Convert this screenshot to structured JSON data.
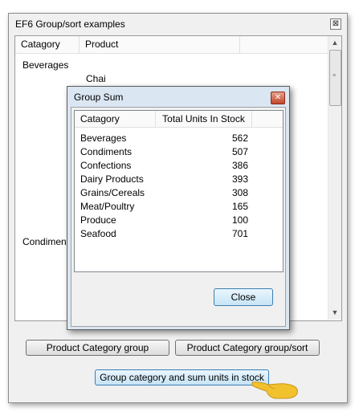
{
  "main_window": {
    "title": "EF6 Group/sort examples",
    "close_glyph": "⊠"
  },
  "list": {
    "columns": [
      "Catagory",
      "Product"
    ],
    "rows": [
      {
        "category": "Beverages",
        "product": ""
      },
      {
        "category": "",
        "product": "Chai"
      },
      {
        "category": "Condiments",
        "product": ""
      }
    ]
  },
  "buttons": {
    "category_group": "Product Category group",
    "category_group_sort": "Product Category group/sort",
    "group_sum": "Group category and sum units in stock"
  },
  "dialog": {
    "title": "Group Sum",
    "close_glyph": "✕",
    "columns": [
      "Catagory",
      "Total Units In Stock"
    ],
    "rows": [
      {
        "category": "Beverages",
        "total": "562"
      },
      {
        "category": "Condiments",
        "total": "507"
      },
      {
        "category": "Confections",
        "total": "386"
      },
      {
        "category": "Dairy Products",
        "total": "393"
      },
      {
        "category": "Grains/Cereals",
        "total": "308"
      },
      {
        "category": "Meat/Poultry",
        "total": "165"
      },
      {
        "category": "Produce",
        "total": "100"
      },
      {
        "category": "Seafood",
        "total": "701"
      }
    ],
    "close_label": "Close"
  },
  "colors": {
    "window_bg": "#f0f0f0",
    "dialog_frame": "#dbe6f3",
    "default_button_border": "#3c7fb1",
    "close_button_red": "#c2452b",
    "cursor_yellow": "#f2c12e"
  },
  "icons": {
    "cursor": "pointing-hand-icon"
  }
}
